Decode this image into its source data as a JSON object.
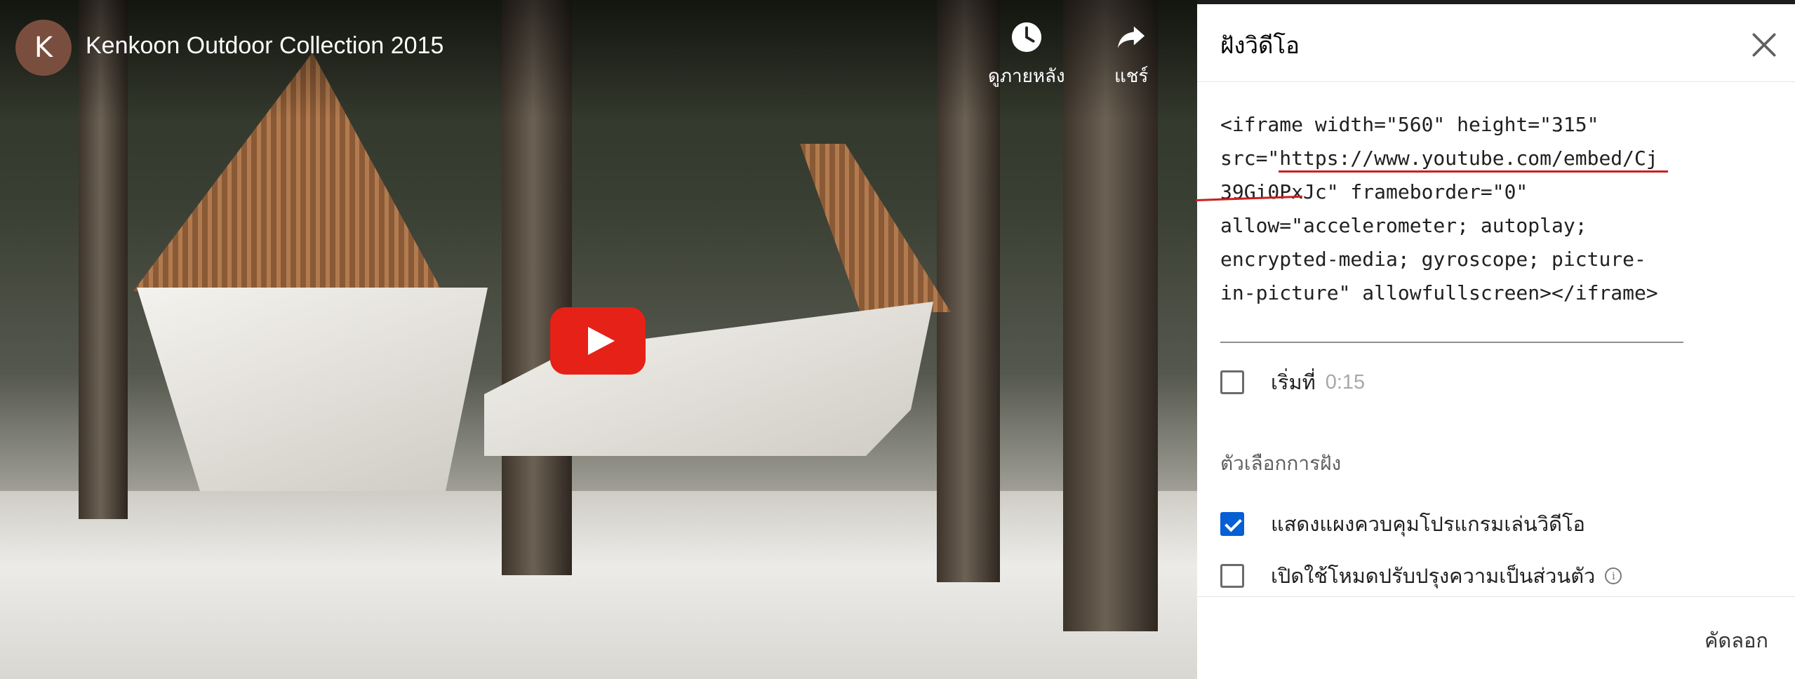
{
  "video": {
    "channel_initial": "K",
    "title": "Kenkoon Outdoor Collection 2015",
    "watch_later_label": "ดูภายหลัง",
    "share_label": "แชร์",
    "play_button_color": "#e62117"
  },
  "dialog": {
    "title": "ฝังวิดีโอ",
    "embed_code": "<iframe width=\"560\" height=\"315\"\nsrc=\"https://www.youtube.com/embed/Cj\n39Gi0PxJc\" frameborder=\"0\"\nallow=\"accelerometer; autoplay;\nencrypted-media; gyroscope; picture-\nin-picture\" allowfullscreen></iframe>",
    "start_at_label": "เริ่มที่",
    "start_at_time": "0:15",
    "options_heading": "ตัวเลือกการฝัง",
    "options": [
      {
        "label": "แสดงแผงควบคุมโปรแกรมเล่นวิดีโอ",
        "checked": true
      },
      {
        "label": "เปิดใช้โหมดปรับปรุงความเป็นส่วนตัว",
        "checked": false
      }
    ],
    "copy_label": "คัดลอก",
    "accent_color": "#065fd4",
    "annotation_color": "#cc1f1f"
  }
}
